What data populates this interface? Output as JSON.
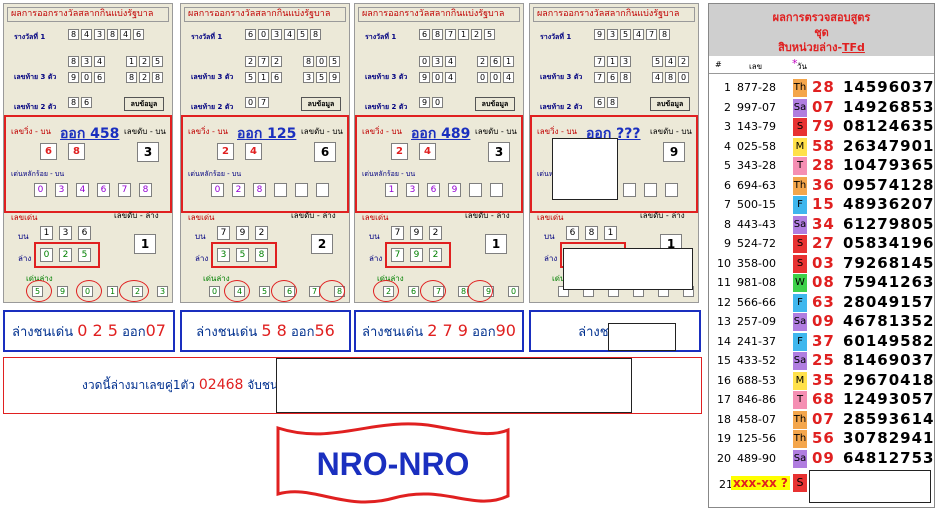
{
  "panels": [
    {
      "title": "ผลการออกรางวัลสลากกินแบ่งรัฐบาล",
      "row1_label": "รางวัลที่ 1",
      "row1": [
        "8",
        "4",
        "3",
        "8",
        "4",
        "6"
      ],
      "back3_label": "เลขท้าย 3 ตัว",
      "back3a": [
        "8",
        "3",
        "4"
      ],
      "back3b": [
        "1",
        "2",
        "5"
      ],
      "back3c": [
        "9",
        "0",
        "6"
      ],
      "back3d": [
        "8",
        "2",
        "8"
      ],
      "back2_label": "เลขท้าย 2 ตัว",
      "back2": [
        "8",
        "6"
      ],
      "btn": "ลบข้อมูล",
      "run_top_label": "เลขวิ่ง - บน",
      "sit_top_label": "เลขดับ - บน",
      "out": "ออก 458",
      "run_top": [
        "6",
        "8"
      ],
      "sit_top": "3",
      "hundreds_label": "เด่นหลักร้อย - บน",
      "hundreds": [
        "0",
        "3",
        "4",
        "6",
        "7",
        "8"
      ],
      "lead_label": "เลขเด่น",
      "sit_low_label": "เลขดับ - ล่าง",
      "up_label": "บน",
      "low_label": "ล่าง",
      "lead_up": [
        "1",
        "3",
        "6"
      ],
      "lead_low": [
        "0",
        "2",
        "5"
      ],
      "sit_low": "1",
      "lead_low2_label": "เด่นล่าง",
      "lead_low2": [
        "5",
        "9",
        "0",
        "1",
        "2",
        "3"
      ],
      "blue_text": "ล่างชนเด่น",
      "blue_nums": "0 2 5",
      "blue_out": "ออก",
      "blue_res": "07"
    },
    {
      "title": "ผลการออกรางวัลสลากกินแบ่งรัฐบาล",
      "row1_label": "รางวัลที่ 1",
      "row1": [
        "6",
        "0",
        "3",
        "4",
        "5",
        "8"
      ],
      "back3_label": "เลขท้าย 3 ตัว",
      "back3a": [
        "2",
        "7",
        "2"
      ],
      "back3b": [
        "8",
        "0",
        "5"
      ],
      "back3c": [
        "5",
        "1",
        "6"
      ],
      "back3d": [
        "3",
        "5",
        "9"
      ],
      "back2_label": "เลขท้าย 2 ตัว",
      "back2": [
        "0",
        "7"
      ],
      "btn": "ลบข้อมูล",
      "run_top_label": "เลขวิ่ง - บน",
      "sit_top_label": "เลขดับ - บน",
      "out": "ออก 125",
      "run_top": [
        "2",
        "4"
      ],
      "sit_top": "6",
      "hundreds_label": "เด่นหลักร้อย - บน",
      "hundreds": [
        "0",
        "2",
        "8",
        "",
        "",
        ""
      ],
      "lead_label": "เลขเด่น",
      "sit_low_label": "เลขดับ - ล่าง",
      "up_label": "บน",
      "low_label": "ล่าง",
      "lead_up": [
        "7",
        "9",
        "2"
      ],
      "lead_low": [
        "3",
        "5",
        "8"
      ],
      "sit_low": "2",
      "lead_low2_label": "เด่นล่าง",
      "lead_low2": [
        "0",
        "4",
        "5",
        "6",
        "7",
        "8"
      ],
      "blue_text": "ล่างชนเด่น",
      "blue_nums": "5 8",
      "blue_out": "ออก",
      "blue_res": "56"
    },
    {
      "title": "ผลการออกรางวัลสลากกินแบ่งรัฐบาล",
      "row1_label": "รางวัลที่ 1",
      "row1": [
        "6",
        "8",
        "7",
        "1",
        "2",
        "5"
      ],
      "back3_label": "เลขท้าย 3 ตัว",
      "back3a": [
        "0",
        "3",
        "4"
      ],
      "back3b": [
        "2",
        "6",
        "1"
      ],
      "back3c": [
        "9",
        "0",
        "4"
      ],
      "back3d": [
        "0",
        "0",
        "4"
      ],
      "back2_label": "เลขท้าย 2 ตัว",
      "back2": [
        "9",
        "0"
      ],
      "btn": "ลบข้อมูล",
      "run_top_label": "เลขวิ่ง - บน",
      "sit_top_label": "เลขดับ - บน",
      "out": "ออก 489",
      "run_top": [
        "2",
        "4"
      ],
      "sit_top": "3",
      "hundreds_label": "เด่นหลักร้อย - บน",
      "hundreds": [
        "1",
        "3",
        "6",
        "9",
        "",
        ""
      ],
      "lead_label": "เลขเด่น",
      "sit_low_label": "เลขดับ - ล่าง",
      "up_label": "บน",
      "low_label": "ล่าง",
      "lead_up": [
        "7",
        "9",
        "2"
      ],
      "lead_low": [
        "7",
        "9",
        "2"
      ],
      "sit_low": "1",
      "lead_low2_label": "เด่นล่าง",
      "lead_low2": [
        "2",
        "6",
        "7",
        "8",
        "9",
        "0"
      ],
      "blue_text": "ล่างชนเด่น",
      "blue_nums": "2 7 9",
      "blue_out": "ออก",
      "blue_res": "90"
    },
    {
      "title": "ผลการออกรางวัลสลากกินแบ่งรัฐบาล",
      "row1_label": "รางวัลที่ 1",
      "row1": [
        "9",
        "3",
        "5",
        "4",
        "7",
        "8"
      ],
      "back3_label": "เลขท้าย 3 ตัว",
      "back3a": [
        "7",
        "1",
        "3"
      ],
      "back3b": [
        "5",
        "4",
        "2"
      ],
      "back3c": [
        "7",
        "6",
        "8"
      ],
      "back3d": [
        "4",
        "8",
        "0"
      ],
      "back2_label": "เลขท้าย 2 ตัว",
      "back2": [
        "6",
        "8"
      ],
      "btn": "ลบข้อมูล",
      "run_top_label": "เลขวิ่ง - บน",
      "sit_top_label": "เลขดับ - บน",
      "out": "ออก ???",
      "run_top": [
        "",
        ""
      ],
      "sit_top": "9",
      "hundreds_label": "เด่นหลักร้อย - บน",
      "hundreds": [
        "",
        "",
        "",
        "",
        "",
        ""
      ],
      "lead_label": "เลขเด่น",
      "sit_low_label": "เลขดับ - ล่าง",
      "up_label": "บน",
      "low_label": "ล่าง",
      "lead_up": [
        "6",
        "8",
        "1"
      ],
      "lead_low": [
        "",
        "",
        ""
      ],
      "sit_low": "1",
      "lead_low2_label": "เด่นล่าง",
      "lead_low2": [
        "",
        "",
        "",
        "",
        "",
        ""
      ],
      "blue_text": "ล่างชนเด่น",
      "blue_nums": "",
      "blue_out": "",
      "blue_res": "?"
    }
  ],
  "bottom_note": "งวดนี้ล่างมาเลขคู่1ตัว",
  "bottom_nums": "02468",
  "bottom_suffix": "จับชน",
  "banner": "NRO-NRO",
  "right": {
    "title1": "ผลการตรวจสอบสูตร",
    "title2": "ชุด",
    "title3_prefix": "สิบหน่วยล่าง-",
    "title3_suffix": "TFd",
    "col_no": "#",
    "col_num": "เลข",
    "col_star": "*",
    "col_day": "วัน",
    "rows": [
      {
        "n": "1",
        "code": "877-28",
        "day": "Th",
        "c": "#f4a64b",
        "big": "28",
        "res": "14596037"
      },
      {
        "n": "2",
        "code": "997-07",
        "day": "Sa",
        "c": "#b07de0",
        "big": "07",
        "res": "14926853"
      },
      {
        "n": "3",
        "code": "143-79",
        "day": "S",
        "c": "#e83232",
        "big": "79",
        "res": "08124635"
      },
      {
        "n": "4",
        "code": "025-58",
        "day": "M",
        "c": "#ffe14a",
        "big": "58",
        "res": "26347901"
      },
      {
        "n": "5",
        "code": "343-28",
        "day": "T",
        "c": "#f58fb3",
        "big": "28",
        "res": "10479365"
      },
      {
        "n": "6",
        "code": "694-63",
        "day": "Th",
        "c": "#f4a64b",
        "big": "36",
        "res": "09574128"
      },
      {
        "n": "7",
        "code": "500-15",
        "day": "F",
        "c": "#3fb7ee",
        "big": "15",
        "res": "48936207"
      },
      {
        "n": "8",
        "code": "443-43",
        "day": "Sa",
        "c": "#b07de0",
        "big": "34",
        "res": "61279805"
      },
      {
        "n": "9",
        "code": "524-72",
        "day": "S",
        "c": "#e83232",
        "big": "27",
        "res": "05834196"
      },
      {
        "n": "10",
        "code": "358-00",
        "day": "S",
        "c": "#e83232",
        "big": "03",
        "res": "79268145"
      },
      {
        "n": "11",
        "code": "981-08",
        "day": "W",
        "c": "#3ed14a",
        "big": "08",
        "res": "75941263"
      },
      {
        "n": "12",
        "code": "566-66",
        "day": "F",
        "c": "#3fb7ee",
        "big": "63",
        "res": "28049157"
      },
      {
        "n": "13",
        "code": "257-09",
        "day": "Sa",
        "c": "#b07de0",
        "big": "09",
        "res": "46781352"
      },
      {
        "n": "14",
        "code": "241-37",
        "day": "F",
        "c": "#3fb7ee",
        "big": "37",
        "res": "60149582"
      },
      {
        "n": "15",
        "code": "433-52",
        "day": "Sa",
        "c": "#b07de0",
        "big": "25",
        "res": "81469037"
      },
      {
        "n": "16",
        "code": "688-53",
        "day": "M",
        "c": "#ffe14a",
        "big": "35",
        "res": "29670418"
      },
      {
        "n": "17",
        "code": "846-86",
        "day": "T",
        "c": "#f58fb3",
        "big": "68",
        "res": "12493057"
      },
      {
        "n": "18",
        "code": "458-07",
        "day": "Th",
        "c": "#f4a64b",
        "big": "07",
        "res": "28593614"
      },
      {
        "n": "19",
        "code": "125-56",
        "day": "Th",
        "c": "#f4a64b",
        "big": "56",
        "res": "30782941"
      },
      {
        "n": "20",
        "code": "489-90",
        "day": "Sa",
        "c": "#b07de0",
        "big": "09",
        "res": "64812753"
      }
    ],
    "last_n": "21",
    "last_code": "xxx-xx ?",
    "last_day": "S"
  }
}
